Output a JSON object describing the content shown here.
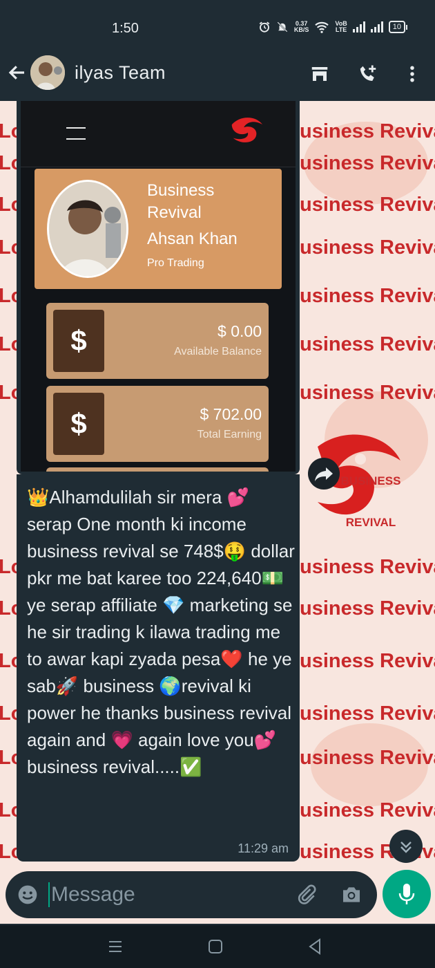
{
  "status_bar": {
    "time": "1:50",
    "net_speed_value": "0.37",
    "net_speed_unit": "KB/S",
    "volte_top": "VoB",
    "volte_bottom": "LTE",
    "battery": "10"
  },
  "header": {
    "contact_name": "ilyas  Team",
    "icons": [
      "back-arrow-icon",
      "store-icon",
      "add-call-icon",
      "more-vert-icon"
    ]
  },
  "wallpaper": {
    "text_right": "usiness Reviva",
    "text_right_alt": "usiness Revival",
    "text_left": "Lo",
    "logo_text": "BUSINESS REVIVAL"
  },
  "screenshot_app": {
    "profile": {
      "title": "Business Revival",
      "name": "Ahsan Khan",
      "role": "Pro Trading"
    },
    "balances": [
      {
        "symbol": "$",
        "amount": "$ 0.00",
        "label": "Available Balance"
      },
      {
        "symbol": "$",
        "amount": "$ 702.00",
        "label": "Total Earning"
      }
    ]
  },
  "message": {
    "text": "👑Alhamdulilah sir mera 💕 serap One month ki income business revival se 748$🤑 dollar pkr me bat karee too 224,640💵 ye serap affiliate 💎 marketing se he sir trading k ilawa trading me to awar kapi zyada pesa❤️ he ye sab🚀 business 🌍revival ki power he thanks business revival again and 💗 again love you💕 business revival.....✅",
    "time": "11:29 am"
  },
  "input": {
    "placeholder": "Message"
  },
  "colors": {
    "header_bg": "#1f2c34",
    "accent": "#00a884",
    "wallpaper_text": "#c8292b",
    "card": "#d79a64"
  }
}
